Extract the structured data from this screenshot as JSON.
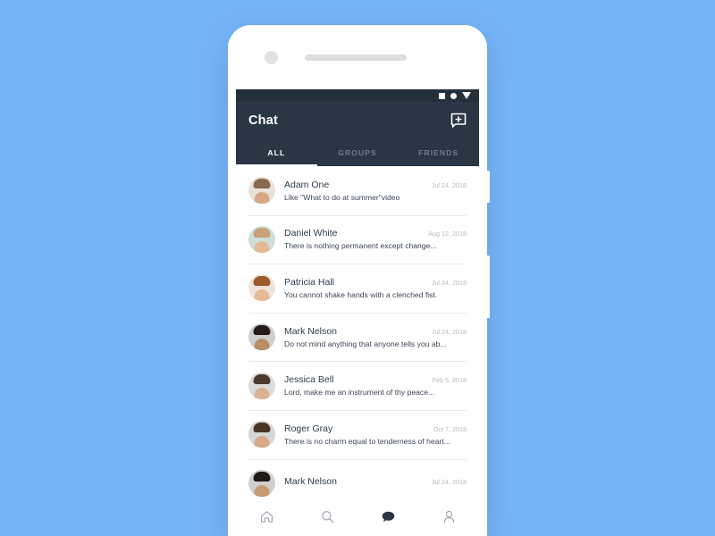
{
  "theme": {
    "page_background": "#76b4f8",
    "appbar_background": "#2b3644",
    "statusbar_background": "#232f3b",
    "accent_text": "#ffffff",
    "inactive_tab_text": "#6f7c8b",
    "name_text": "#2f3b49",
    "date_text": "#b5bac2",
    "divider": "#ececec",
    "nav_inactive": "#9aa2ab",
    "nav_active": "#2b3644"
  },
  "device": {
    "camera_icon": "camera-dot",
    "speaker_icon": "speaker-grille",
    "side_button_upper": "volume-button",
    "side_button_lower": "power-button"
  },
  "statusbar": {
    "icons": [
      {
        "name": "square-icon",
        "glyph": "square"
      },
      {
        "name": "circle-icon",
        "glyph": "circle"
      },
      {
        "name": "dropdown-triangle-icon",
        "glyph": "triangle-down"
      }
    ]
  },
  "appbar": {
    "title": "Chat",
    "action_icon": "new-message-icon",
    "action_label": "New message"
  },
  "tabs": [
    {
      "label": "ALL",
      "active": true
    },
    {
      "label": "GROUPS",
      "active": false
    },
    {
      "label": "FRIENDS",
      "active": false
    }
  ],
  "chats": [
    {
      "name": "Adam One",
      "message": "Like \"What to do at summer\"video",
      "date": "Jul 24, 2018",
      "avatar": {
        "skin": "#d9a884",
        "hair": "#8a6a4b",
        "body": "#7f9bb3",
        "bg": "#e8e2da"
      }
    },
    {
      "name": "Daniel White",
      "message": "There is nothing permanent except change...",
      "date": "Aug 12, 2018",
      "avatar": {
        "skin": "#e3b996",
        "hair": "#c8a07a",
        "body": "#8fb1ad",
        "bg": "#cfded9"
      }
    },
    {
      "name": "Patricia Hall",
      "message": "You cannot shake hands with a clenched fist.",
      "date": "Jul 24, 2018",
      "avatar": {
        "skin": "#e6bb98",
        "hair": "#9d5a2e",
        "body": "#f2f2f2",
        "bg": "#efe4dc"
      }
    },
    {
      "name": "Mark Nelson",
      "message": "Do not mind anything that anyone tells you ab...",
      "date": "Jul 24, 2018",
      "avatar": {
        "skin": "#b98d68",
        "hair": "#241c18",
        "body": "#3d3530",
        "bg": "#cfcfcf"
      }
    },
    {
      "name": "Jessica Bell",
      "message": "Lord, make me an instrument of thy peace...",
      "date": "Feb 5, 2018",
      "avatar": {
        "skin": "#dcb294",
        "hair": "#4b3a2e",
        "body": "#b9bec4",
        "bg": "#dcdcdc"
      }
    },
    {
      "name": "Roger Gray",
      "message": "There is no charm equal to tenderness of heart...",
      "date": "Oct 7, 2018",
      "avatar": {
        "skin": "#d9a985",
        "hair": "#4a3526",
        "body": "#2e3a46",
        "bg": "#d6d6d6"
      }
    },
    {
      "name": "Mark Nelson",
      "message": "",
      "date": "Jul 24, 2018",
      "avatar": {
        "skin": "#c79a72",
        "hair": "#1f1a16",
        "body": "#2f2a26",
        "bg": "#d0d0d0"
      }
    }
  ],
  "bottom_nav": [
    {
      "name": "home",
      "icon": "home-icon",
      "active": false
    },
    {
      "name": "search",
      "icon": "search-icon",
      "active": false
    },
    {
      "name": "chat",
      "icon": "chat-bubble-icon",
      "active": true
    },
    {
      "name": "profile",
      "icon": "person-icon",
      "active": false
    }
  ]
}
